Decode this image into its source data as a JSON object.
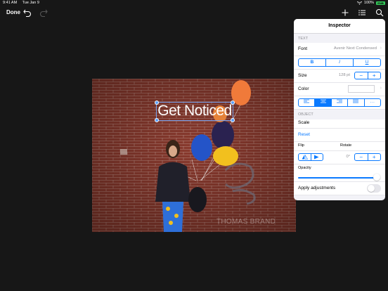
{
  "status": {
    "time": "9:41 AM",
    "date": "Tue Jan 9",
    "battery": "100%",
    "battery_badge": "ENB"
  },
  "toolbar": {
    "done_label": "Done"
  },
  "canvas": {
    "overlay_text": "Get Noticed",
    "watermark": "THOMAS BRAND"
  },
  "inspector": {
    "title": "Inspector",
    "text_section": "TEXT",
    "font_label": "Font",
    "font_value": "Avenir Next Condensed",
    "style_buttons": [
      "B",
      "I",
      "U"
    ],
    "size_label": "Size",
    "size_value": "128 pt",
    "color_label": "Color",
    "align_more": "···",
    "object_section": "OBJECT",
    "scale_label": "Scale",
    "reset_label": "Reset",
    "flip_label": "Flip",
    "rotate_label": "Rotate",
    "rotate_value": "0°",
    "opacity_label": "Opacity",
    "opacity_value": 1.0,
    "apply_label": "Apply adjustments",
    "apply_on": false,
    "accent": "#0a7aff"
  }
}
